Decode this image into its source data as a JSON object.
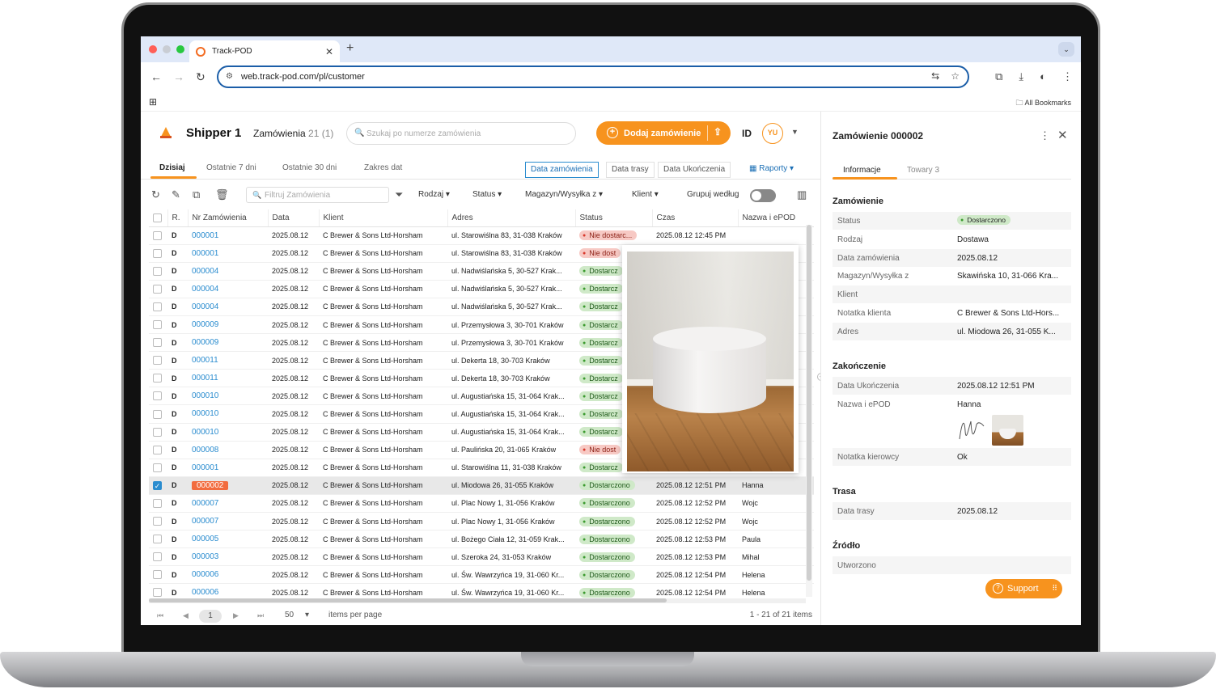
{
  "browser": {
    "tab_title": "Track-POD",
    "url": "web.track-pod.com/pl/customer",
    "all_bookmarks": "All Bookmarks"
  },
  "header": {
    "shipper": "Shipper 1",
    "orders_label": "Zamówienia",
    "orders_count": "21 (1)",
    "search_placeholder": "Szukaj po numerze zamówienia",
    "add_order": "Dodaj zamówienie",
    "id_label": "ID",
    "avatar": "YU"
  },
  "date_tabs": [
    "Dzisiaj",
    "Ostatnie 7 dni",
    "Ostatnie 30 dni",
    "Zakres dat"
  ],
  "date_modes": [
    "Data zamówienia",
    "Data trasy",
    "Data Ukończenia"
  ],
  "reports": "Raporty",
  "filters": {
    "placeholder": "Filtruj Zamówienia",
    "rodzaj": "Rodzaj",
    "status": "Status",
    "magazyn": "Magazyn/Wysyłka z",
    "klient": "Klient",
    "grupuj": "Grupuj według"
  },
  "columns": [
    "R.",
    "Nr Zamówienia",
    "Data",
    "Klient",
    "Adres",
    "Status",
    "Czas",
    "Nazwa i ePOD"
  ],
  "rows": [
    {
      "r": "D",
      "nr": "000001",
      "data": "2025.08.12",
      "klient": "C Brewer & Sons Ltd-Horsham",
      "adres": "ul. Starowiślna 83, 31-038 Kraków",
      "status": "Nie dostarc...",
      "ok": false,
      "czas": "2025.08.12 12:45 PM",
      "epod": ""
    },
    {
      "r": "D",
      "nr": "000001",
      "data": "2025.08.12",
      "klient": "C Brewer & Sons Ltd-Horsham",
      "adres": "ul. Starowiślna 83, 31-038 Kraków",
      "status": "Nie dost",
      "ok": false,
      "czas": "",
      "epod": ""
    },
    {
      "r": "D",
      "nr": "000004",
      "data": "2025.08.12",
      "klient": "C Brewer & Sons Ltd-Horsham",
      "adres": "ul. Nadwiślańska 5, 30-527 Krak...",
      "status": "Dostarcz",
      "ok": true,
      "czas": "",
      "epod": ""
    },
    {
      "r": "D",
      "nr": "000004",
      "data": "2025.08.12",
      "klient": "C Brewer & Sons Ltd-Horsham",
      "adres": "ul. Nadwiślańska 5, 30-527 Krak...",
      "status": "Dostarcz",
      "ok": true,
      "czas": "",
      "epod": ""
    },
    {
      "r": "D",
      "nr": "000004",
      "data": "2025.08.12",
      "klient": "C Brewer & Sons Ltd-Horsham",
      "adres": "ul. Nadwiślańska 5, 30-527 Krak...",
      "status": "Dostarcz",
      "ok": true,
      "czas": "",
      "epod": ""
    },
    {
      "r": "D",
      "nr": "000009",
      "data": "2025.08.12",
      "klient": "C Brewer & Sons Ltd-Horsham",
      "adres": "ul. Przemysłowa 3, 30-701 Kraków",
      "status": "Dostarcz",
      "ok": true,
      "czas": "",
      "epod": ""
    },
    {
      "r": "D",
      "nr": "000009",
      "data": "2025.08.12",
      "klient": "C Brewer & Sons Ltd-Horsham",
      "adres": "ul. Przemysłowa 3, 30-701 Kraków",
      "status": "Dostarcz",
      "ok": true,
      "czas": "",
      "epod": ""
    },
    {
      "r": "D",
      "nr": "000011",
      "data": "2025.08.12",
      "klient": "C Brewer & Sons Ltd-Horsham",
      "adres": "ul. Dekerta 18, 30-703 Kraków",
      "status": "Dostarcz",
      "ok": true,
      "czas": "",
      "epod": ""
    },
    {
      "r": "D",
      "nr": "000011",
      "data": "2025.08.12",
      "klient": "C Brewer & Sons Ltd-Horsham",
      "adres": "ul. Dekerta 18, 30-703 Kraków",
      "status": "Dostarcz",
      "ok": true,
      "czas": "",
      "epod": ""
    },
    {
      "r": "D",
      "nr": "000010",
      "data": "2025.08.12",
      "klient": "C Brewer & Sons Ltd-Horsham",
      "adres": "ul. Augustiańska 15, 31-064 Krak...",
      "status": "Dostarcz",
      "ok": true,
      "czas": "",
      "epod": ""
    },
    {
      "r": "D",
      "nr": "000010",
      "data": "2025.08.12",
      "klient": "C Brewer & Sons Ltd-Horsham",
      "adres": "ul. Augustiańska 15, 31-064 Krak...",
      "status": "Dostarcz",
      "ok": true,
      "czas": "",
      "epod": ""
    },
    {
      "r": "D",
      "nr": "000010",
      "data": "2025.08.12",
      "klient": "C Brewer & Sons Ltd-Horsham",
      "adres": "ul. Augustiańska 15, 31-064 Krak...",
      "status": "Dostarcz",
      "ok": true,
      "czas": "",
      "epod": ""
    },
    {
      "r": "D",
      "nr": "000008",
      "data": "2025.08.12",
      "klient": "C Brewer & Sons Ltd-Horsham",
      "adres": "ul. Paulińska 20, 31-065 Kraków",
      "status": "Nie dost",
      "ok": false,
      "czas": "",
      "epod": ""
    },
    {
      "r": "D",
      "nr": "000001",
      "data": "2025.08.12",
      "klient": "C Brewer & Sons Ltd-Horsham",
      "adres": "ul. Starowiślna 11, 31-038 Kraków",
      "status": "Dostarcz",
      "ok": true,
      "czas": "",
      "epod": ""
    },
    {
      "r": "D",
      "nr": "000002",
      "data": "2025.08.12",
      "klient": "C Brewer & Sons Ltd-Horsham",
      "adres": "ul. Miodowa 26, 31-055 Kraków",
      "status": "Dostarczono",
      "ok": true,
      "czas": "2025.08.12 12:51 PM",
      "epod": "Hanna",
      "selected": true
    },
    {
      "r": "D",
      "nr": "000007",
      "data": "2025.08.12",
      "klient": "C Brewer & Sons Ltd-Horsham",
      "adres": "ul. Plac Nowy 1, 31-056 Kraków",
      "status": "Dostarczono",
      "ok": true,
      "czas": "2025.08.12 12:52 PM",
      "epod": "Wojc"
    },
    {
      "r": "D",
      "nr": "000007",
      "data": "2025.08.12",
      "klient": "C Brewer & Sons Ltd-Horsham",
      "adres": "ul. Plac Nowy 1, 31-056 Kraków",
      "status": "Dostarczono",
      "ok": true,
      "czas": "2025.08.12 12:52 PM",
      "epod": "Wojc"
    },
    {
      "r": "D",
      "nr": "000005",
      "data": "2025.08.12",
      "klient": "C Brewer & Sons Ltd-Horsham",
      "adres": "ul. Bożego Ciała 12, 31-059 Krak...",
      "status": "Dostarczono",
      "ok": true,
      "czas": "2025.08.12 12:53 PM",
      "epod": "Paula"
    },
    {
      "r": "D",
      "nr": "000003",
      "data": "2025.08.12",
      "klient": "C Brewer & Sons Ltd-Horsham",
      "adres": "ul. Szeroka 24, 31-053 Kraków",
      "status": "Dostarczono",
      "ok": true,
      "czas": "2025.08.12 12:53 PM",
      "epod": "Mihal"
    },
    {
      "r": "D",
      "nr": "000006",
      "data": "2025.08.12",
      "klient": "C Brewer & Sons Ltd-Horsham",
      "adres": "ul. Św. Wawrzyńca 19, 31-060 Kr...",
      "status": "Dostarczono",
      "ok": true,
      "czas": "2025.08.12 12:54 PM",
      "epod": "Helena"
    },
    {
      "r": "D",
      "nr": "000006",
      "data": "2025.08.12",
      "klient": "C Brewer & Sons Ltd-Horsham",
      "adres": "ul. Św. Wawrzyńca 19, 31-060 Kr...",
      "status": "Dostarczono",
      "ok": true,
      "czas": "2025.08.12 12:54 PM",
      "epod": "Helena"
    }
  ],
  "pager": {
    "current": "1",
    "page_size": "50",
    "items_per_page": "items per page",
    "range": "1 - 21 of 21 items"
  },
  "side": {
    "title": "Zamówienie 000002",
    "tabs": [
      "Informacje",
      "Towary 3"
    ],
    "sections": {
      "order": "Zamówienie",
      "completion": "Zakończenie",
      "route": "Trasa",
      "source": "Źródło"
    },
    "order_fields": [
      {
        "k": "Status",
        "v": "Dostarczono"
      },
      {
        "k": "Rodzaj",
        "v": "Dostawa"
      },
      {
        "k": "Data zamówienia",
        "v": "2025.08.12"
      },
      {
        "k": "Magazyn/Wysyłka z",
        "v": "Skawińska 10, 31-066 Kra..."
      },
      {
        "k": "Klient",
        "v": ""
      },
      {
        "k": "Notatka klienta",
        "v": "C Brewer & Sons Ltd-Hors..."
      },
      {
        "k": "Adres",
        "v": "ul. Miodowa 26, 31-055 K..."
      }
    ],
    "completion_fields": [
      {
        "k": "Data Ukończenia",
        "v": "2025.08.12 12:51 PM"
      },
      {
        "k": "Nazwa i ePOD",
        "v": "Hanna"
      },
      {
        "k": "Notatka kierowcy",
        "v": "Ok"
      }
    ],
    "route_fields": [
      {
        "k": "Data trasy",
        "v": "2025.08.12"
      }
    ],
    "source_fields": [
      {
        "k": "Utworzono",
        "v": ""
      }
    ],
    "support": "Support"
  },
  "colors": {
    "accent": "#f7931e",
    "link": "#2a8ccf",
    "delivered": "#cfe9c8",
    "not_delivered": "#f7c9c4"
  }
}
